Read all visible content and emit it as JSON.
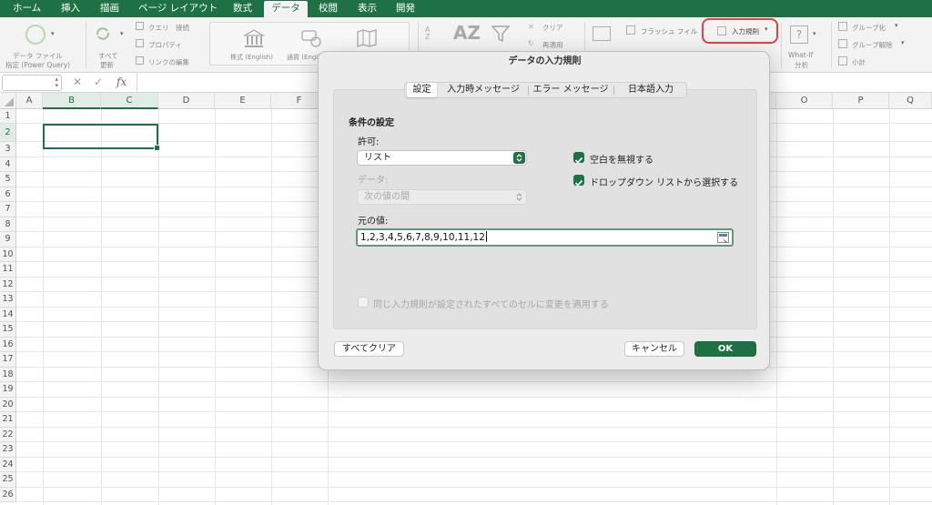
{
  "ribbon_tabs": {
    "home": "ホーム",
    "insert": "挿入",
    "draw": "描画",
    "page_layout": "ページ レイアウト",
    "formulas": "数式",
    "data": "データ",
    "review": "校閲",
    "view": "表示",
    "developer": "開発"
  },
  "ribbon": {
    "get_data_line1": "データ ファイル",
    "get_data_line2": "指定 (Power Query)",
    "refresh_all_line1": "すべて",
    "refresh_all_line2": "更新",
    "queries_connections": "クエリ",
    "connections": "接続",
    "properties": "プロパティ",
    "edit_links": "リンクの編集",
    "stocks": "株式 (English)",
    "currencies": "通貨 (English)",
    "clear": "クリア",
    "reapply": "再適用",
    "flash_fill": "フラッシュ フィル",
    "data_validation": "入力規則",
    "what_if_line1": "What-If",
    "what_if_line2": "分析",
    "group": "グループ化",
    "ungroup": "グループ解除",
    "subtotal": "小計"
  },
  "formula_bar": {
    "fx_label": "fx"
  },
  "columns": [
    "A",
    "B",
    "C",
    "D",
    "E",
    "F",
    "O",
    "P",
    "Q"
  ],
  "rows": [
    "1",
    "2",
    "3",
    "4",
    "5",
    "6",
    "7",
    "8",
    "9",
    "10",
    "11",
    "12",
    "13",
    "14",
    "15",
    "16",
    "17",
    "18",
    "19",
    "20",
    "21",
    "22",
    "23",
    "24",
    "25",
    "26"
  ],
  "dialog": {
    "title": "データの入力規則",
    "tabs": [
      "設定",
      "入力時メッセージ",
      "エラー メッセージ",
      "日本語入力"
    ],
    "active_tab": "設定",
    "section_title": "条件の設定",
    "allow_label": "許可:",
    "allow_value": "リスト",
    "data_label": "データ:",
    "data_value": "次の値の間",
    "ignore_blank": {
      "label": "空白を無視する",
      "checked": true
    },
    "in_cell_dropdown": {
      "label": "ドロップダウン リストから選択する",
      "checked": true
    },
    "source_label": "元の値:",
    "source_value": "1,2,3,4,5,6,7,8,9,10,11,12",
    "apply_all": {
      "label": "同じ入力規則が設定されたすべてのセルに変更を適用する",
      "checked": false
    },
    "clear_all_button": "すべてクリア",
    "cancel_button": "キャンセル",
    "ok_button": "OK"
  },
  "colors": {
    "accent": "#1e7145",
    "highlight": "#e0443e"
  }
}
